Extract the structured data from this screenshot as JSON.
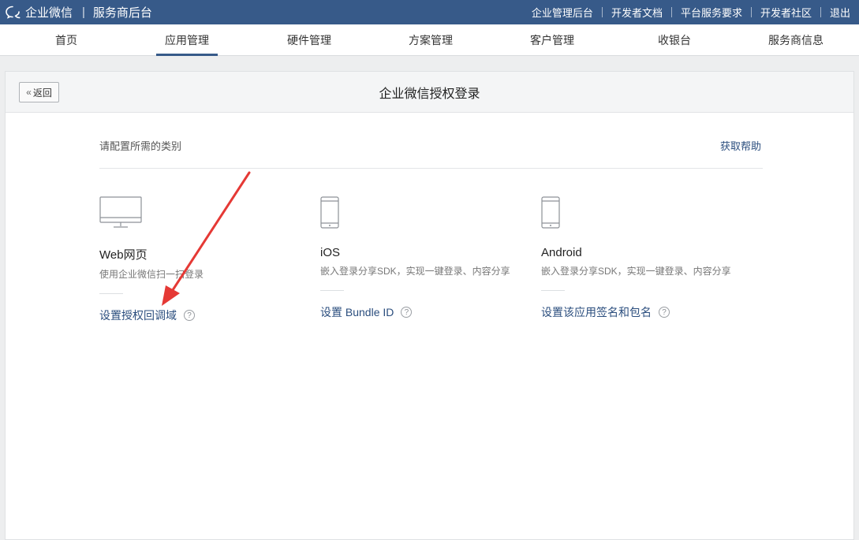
{
  "header": {
    "brand_name": "企业微信",
    "brand_sub": "服务商后台",
    "links": [
      "企业管理后台",
      "开发者文档",
      "平台服务要求",
      "开发者社区",
      "退出"
    ]
  },
  "nav": {
    "tabs": [
      "首页",
      "应用管理",
      "硬件管理",
      "方案管理",
      "客户管理",
      "收银台",
      "服务商信息"
    ],
    "active": "应用管理"
  },
  "panel": {
    "back_label": "返回",
    "title": "企业微信授权登录",
    "subhead": "请配置所需的类别",
    "help_link": "获取帮助"
  },
  "cards": [
    {
      "icon": "monitor-icon",
      "name": "Web网页",
      "desc": "使用企业微信扫一扫登录",
      "action": "设置授权回调域"
    },
    {
      "icon": "phone-icon",
      "name": "iOS",
      "desc": "嵌入登录分享SDK，实现一键登录、内容分享",
      "action": "设置 Bundle ID"
    },
    {
      "icon": "phone-icon",
      "name": "Android",
      "desc": "嵌入登录分享SDK，实现一键登录、内容分享",
      "action": "设置该应用签名和包名"
    }
  ],
  "colors": {
    "topbar": "#375a89",
    "link": "#2b4e7e",
    "annotation_arrow": "#e53935"
  },
  "annotation": {
    "type": "arrow",
    "points_to": "设置授权回调域"
  }
}
